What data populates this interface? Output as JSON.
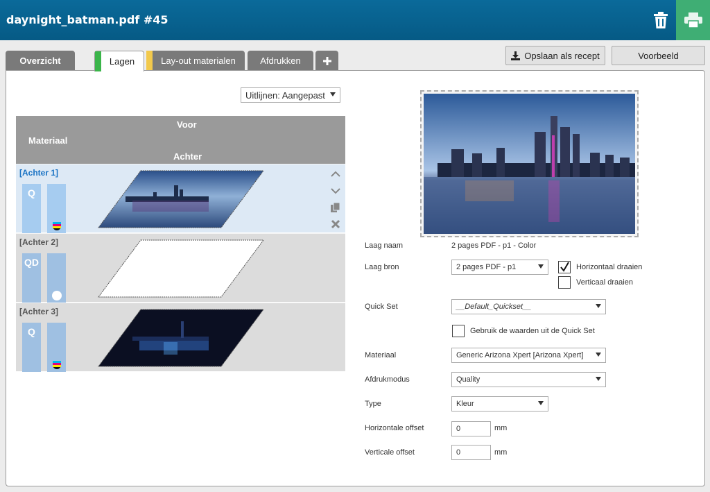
{
  "header": {
    "title": "daynight_batman.pdf #45"
  },
  "icons": {
    "trash": "trash-icon",
    "print": "printer-icon",
    "save": "download-icon",
    "add": "plus-icon"
  },
  "tabs": [
    {
      "label": "Overzicht"
    },
    {
      "label": "Lagen",
      "color": "#3bb54a"
    },
    {
      "label": "Lay-out materialen",
      "color": "#f2c94c"
    },
    {
      "label": "Afdrukken"
    }
  ],
  "toolbar": {
    "save_label": "Opslaan als recept",
    "preview_label": "Voorbeeld"
  },
  "align": {
    "value": "Uitlijnen: Aangepast"
  },
  "layers": {
    "head_voor": "Voor",
    "head_materiaal": "Materiaal",
    "head_achter": "Achter",
    "rows": [
      {
        "label": "[Achter 1]",
        "mode": "Q",
        "ink": "cmyk"
      },
      {
        "label": "[Achter 2]",
        "mode": "QD",
        "ink": "white"
      },
      {
        "label": "[Achter 3]",
        "mode": "Q",
        "ink": "cmyk"
      }
    ]
  },
  "form": {
    "laag_naam_label": "Laag naam",
    "laag_naam_value": "2 pages PDF - p1 - Color",
    "laag_bron_label": "Laag bron",
    "laag_bron_value": "2 pages PDF - p1",
    "horiz_draaien": "Horizontaal draaien",
    "horiz_checked": true,
    "vert_draaien": "Verticaal draaien",
    "vert_checked": false,
    "quickset_label": "Quick Set",
    "quickset_value": "__Default_Quickset__",
    "gebruik_label": "Gebruik de waarden uit de Quick Set",
    "materiaal_label": "Materiaal",
    "materiaal_value": "Generic Arizona Xpert [Arizona Xpert]",
    "afdrukmodus_label": "Afdrukmodus",
    "afdrukmodus_value": "Quality",
    "type_label": "Type",
    "type_value": "Kleur",
    "h_offset_label": "Horizontale offset",
    "h_offset_value": "0",
    "v_offset_label": "Verticale offset",
    "v_offset_value": "0",
    "unit": "mm"
  },
  "colors": {
    "header": "#0a6a9a",
    "print_button": "#3fae74",
    "selected_link": "#1a73c4"
  }
}
